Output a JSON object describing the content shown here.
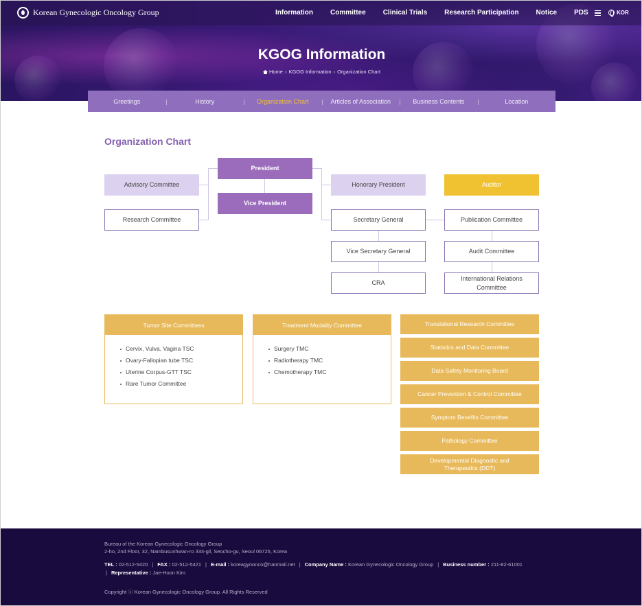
{
  "header": {
    "logo_text": "Korean Gynecologic Oncology Group",
    "nav": [
      "Information",
      "Committee",
      "Clinical Trials",
      "Research Participation",
      "Notice",
      "PDS"
    ],
    "lang": "KOR"
  },
  "hero": {
    "title": "KGOG Information",
    "breadcrumb": [
      "Home",
      "KGOG Information",
      "Organization Chart"
    ]
  },
  "subtabs": [
    "Greetings",
    "History",
    "Organization Chart",
    "Articles of Association",
    "Business Contents",
    "Location"
  ],
  "section_title": "Organization Chart",
  "org": {
    "president": "President",
    "vice_president": "Vice President",
    "advisory": "Advisory Committee",
    "research": "Research Committee",
    "honorary": "Honorary President",
    "auditor": "Auditor",
    "secretary_general": "Secretary General",
    "vice_secretary_general": "Vice Secretary General",
    "cra": "CRA",
    "publication": "Publication Committee",
    "audit": "Audit Committee",
    "international": "International Relations Committee"
  },
  "committees": {
    "tumor_site": {
      "title": "Tumor Site Committees",
      "items": [
        "Cervix, Vulva, Vagina TSC",
        "Ovary-Fallopian tube TSC",
        "Uterine Corpus-GTT TSC",
        "Rare Tumor Committee"
      ]
    },
    "treatment": {
      "title": "Treatment Modality Committee",
      "items": [
        "Surgery TMC",
        "Radiotherapy TMC",
        "Chemotherapy TMC"
      ]
    },
    "others": [
      "Translational Research Committee",
      "Statistics and Data Committee",
      "Data Safety Monitoring Board",
      "Cancer Prevention & Control Committee",
      "Symptom Benefits Committee",
      "Pathology Committee",
      "Developmental Diagnostic and Therapeutics (DDT)"
    ]
  },
  "footer": {
    "bureau": "Bureau of the Korean Gynecologic Oncology Group",
    "address": "2-ho, 2nd Floor, 32, Nambusunhwan-ro 333-gil, Seocho-gu, Seoul 06725, Korea",
    "tel_label": "TEL :",
    "tel": "02-512-5420",
    "fax_label": "FAX :",
    "fax": "02-512-5421",
    "email_label": "E-mail :",
    "email": "koreagynonco@hanmail.net",
    "company_label": "Company Name :",
    "company": "Korean Gynecologic Oncology Group",
    "business_label": "Business number :",
    "business": "211-82-61001",
    "rep_label": "Representative :",
    "rep": "Jae-Hoon Kim",
    "copyright": "Copyright ⓒ Korean Gynecologic Oncology Group. All Rights Reserved"
  }
}
